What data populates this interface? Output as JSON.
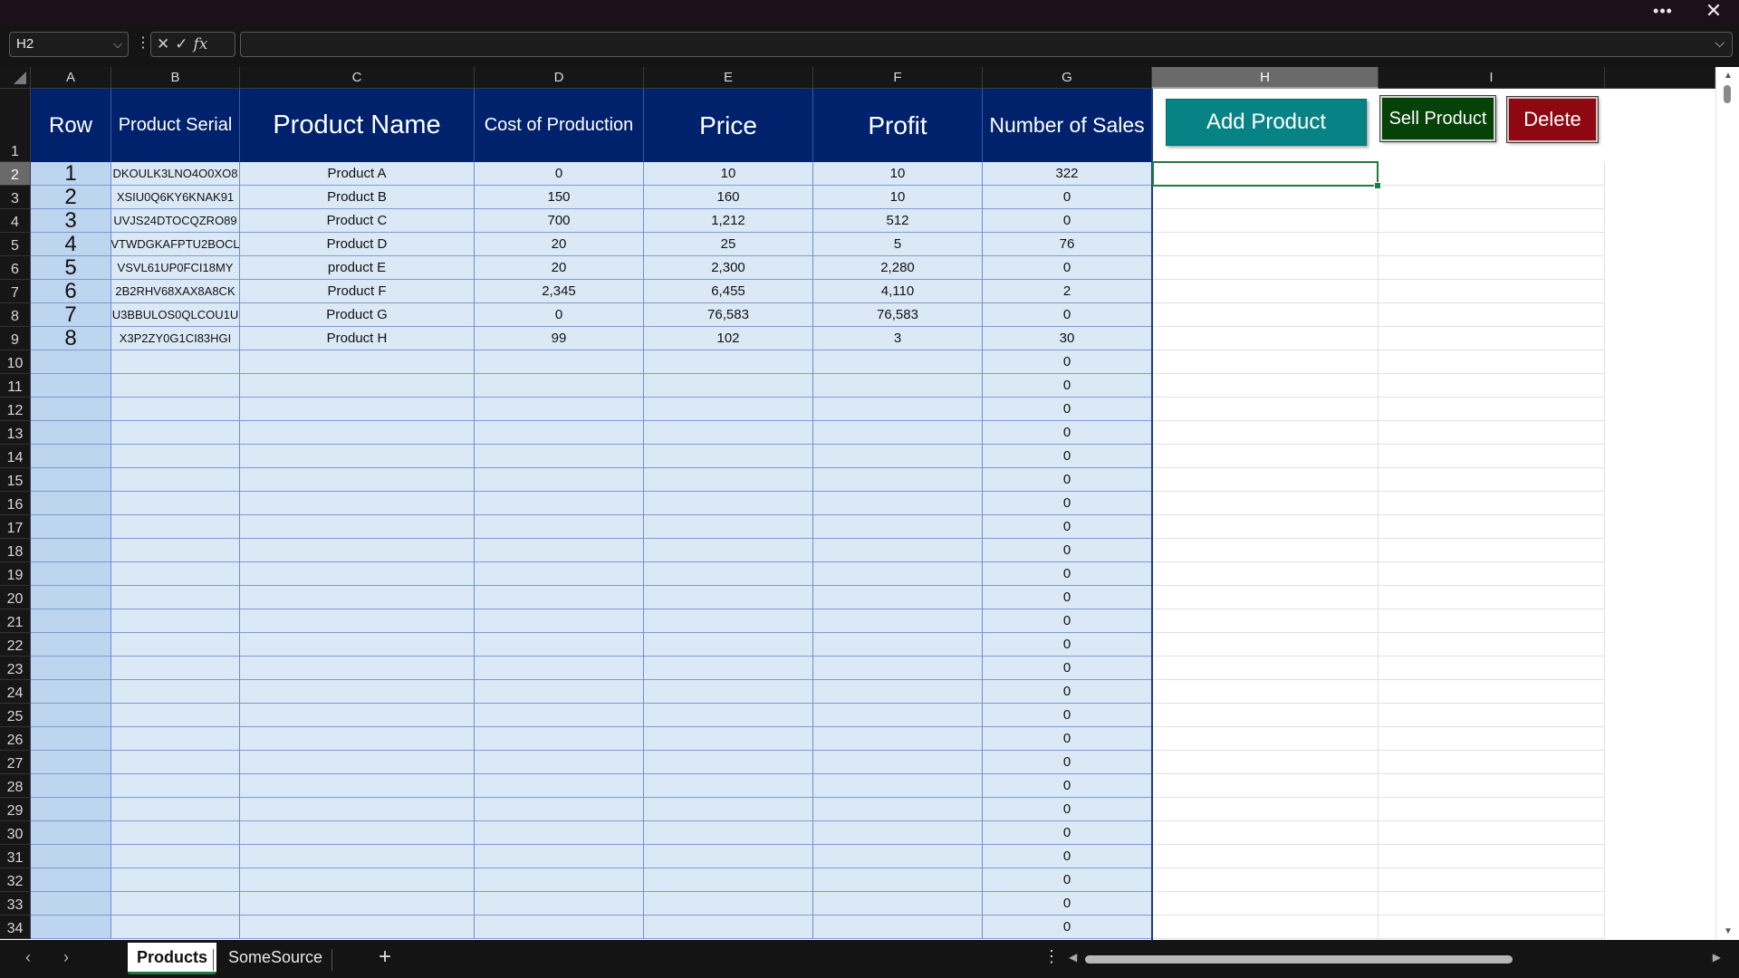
{
  "window": {
    "more_label": "•••",
    "close_label": "✕"
  },
  "formula_bar": {
    "name_box": "H2",
    "formula": "",
    "fx_label": "fx"
  },
  "columns": [
    "A",
    "B",
    "C",
    "D",
    "E",
    "F",
    "G",
    "H",
    "I"
  ],
  "selected_column": "H",
  "selected_cell": "H2",
  "header_row": {
    "row": "Row",
    "serial": "Product Serial",
    "name": "Product Name",
    "cost": "Cost of Production",
    "price": "Price",
    "profit": "Profit",
    "sales": "Number of Sales"
  },
  "products": [
    {
      "row": "1",
      "serial": "DKOULK3LNO4O0XO8",
      "name": "Product A",
      "cost": "0",
      "price": "10",
      "profit": "10",
      "sales": "322"
    },
    {
      "row": "2",
      "serial": "XSIU0Q6KY6KNAK91",
      "name": "Product B",
      "cost": "150",
      "price": "160",
      "profit": "10",
      "sales": "0"
    },
    {
      "row": "3",
      "serial": "UVJS24DTOCQZRO89",
      "name": "Product C",
      "cost": "700",
      "price": "1,212",
      "profit": "512",
      "sales": "0"
    },
    {
      "row": "4",
      "serial": "VTWDGKAFPTU2BOCL",
      "name": "Product D",
      "cost": "20",
      "price": "25",
      "profit": "5",
      "sales": "76"
    },
    {
      "row": "5",
      "serial": "VSVL61UP0FCI18MY",
      "name": "product E",
      "cost": "20",
      "price": "2,300",
      "profit": "2,280",
      "sales": "0"
    },
    {
      "row": "6",
      "serial": "2B2RHV68XAX8A8CK",
      "name": "Product F",
      "cost": "2,345",
      "price": "6,455",
      "profit": "4,110",
      "sales": "2"
    },
    {
      "row": "7",
      "serial": "U3BBULOS0QLCOU1U",
      "name": "Product G",
      "cost": "0",
      "price": "76,583",
      "profit": "76,583",
      "sales": "0"
    },
    {
      "row": "8",
      "serial": "X3P2ZY0G1CI83HGI",
      "name": "Product H",
      "cost": "99",
      "price": "102",
      "profit": "3",
      "sales": "30"
    }
  ],
  "empty_sales_value": "0",
  "row_numbers": [
    "1",
    "2",
    "3",
    "4",
    "5",
    "6",
    "7",
    "8",
    "9",
    "10",
    "11",
    "12",
    "13",
    "14",
    "15",
    "16",
    "17",
    "18",
    "19",
    "20",
    "21",
    "22",
    "23",
    "24",
    "25",
    "26",
    "27",
    "28",
    "29",
    "30",
    "31",
    "32",
    "33",
    "34"
  ],
  "buttons": {
    "add": "Add Product",
    "sell": "Sell Product",
    "delete": "Delete"
  },
  "sheets": [
    {
      "name": "Products",
      "active": true
    },
    {
      "name": "SomeSource",
      "active": false
    }
  ],
  "add_sheet_label": "+",
  "colors": {
    "header_bg": "#00226c",
    "data_bg": "#dbe9f7",
    "row_col_bg": "#bdd5ee",
    "add_btn": "#088385",
    "sell_btn": "#064107",
    "delete_btn": "#8f0711",
    "selection": "#1f7a3f"
  }
}
